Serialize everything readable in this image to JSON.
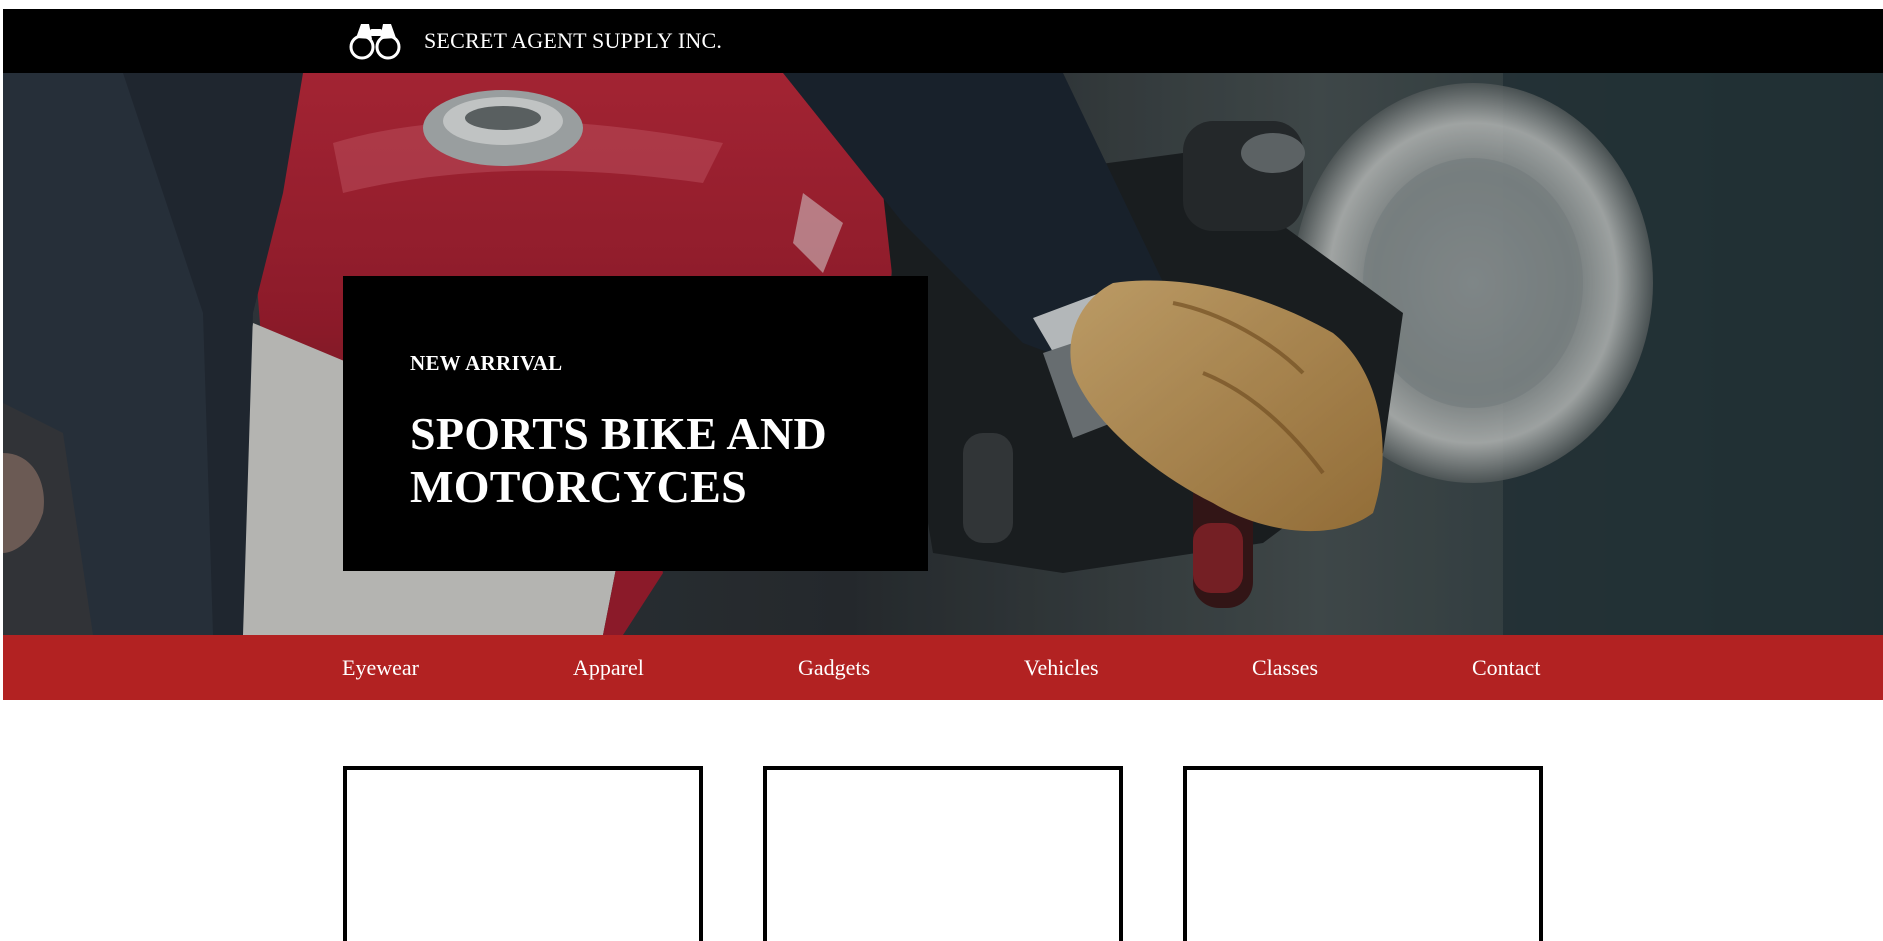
{
  "brand": {
    "logo_icon": "binoculars-icon",
    "name": "SECRET AGENT SUPPLY INC."
  },
  "hero": {
    "eyebrow": "NEW ARRIVAL",
    "title": "SPORTS BIKE AND MOTORCYCES"
  },
  "nav": {
    "items": [
      {
        "label": "Eyewear"
      },
      {
        "label": "Apparel"
      },
      {
        "label": "Gadgets"
      },
      {
        "label": "Vehicles"
      },
      {
        "label": "Classes"
      },
      {
        "label": "Contact"
      }
    ]
  },
  "cards": {
    "count": 3
  },
  "colors": {
    "topbar_bg": "#000000",
    "nav_bg": "#b22222",
    "promo_bg": "#000000",
    "text_light": "#ffffff",
    "card_border": "#000000"
  }
}
